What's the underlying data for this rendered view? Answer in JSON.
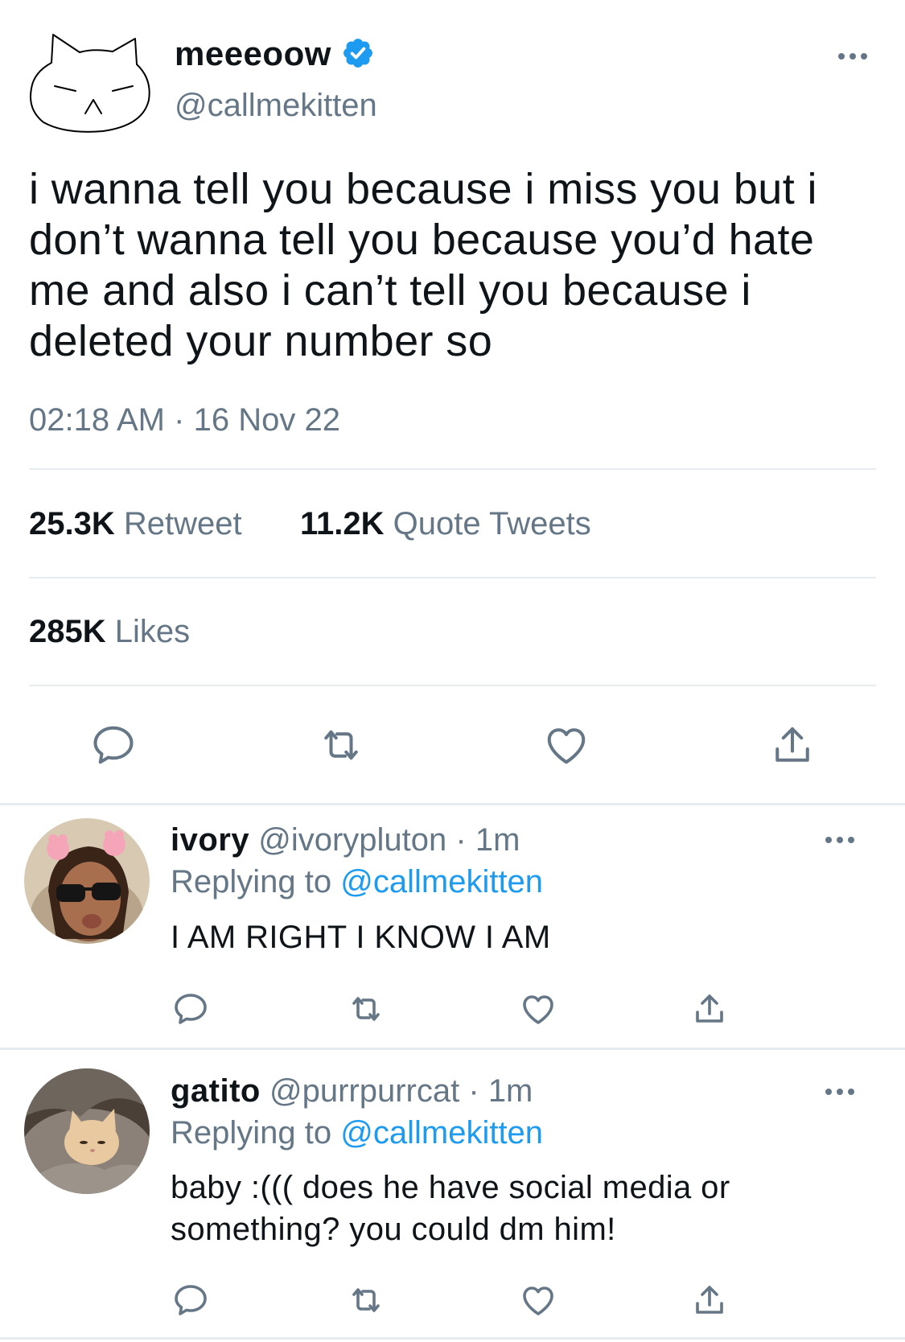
{
  "tweet": {
    "display_name": "meeeoow",
    "handle": "@callmekitten",
    "text": "i wanna tell you because i miss you but i don’t wanna tell you because you’d hate me and also i can’t tell you because i deleted your number so",
    "time": "02:18 AM",
    "separator": "·",
    "date": "16 Nov 22",
    "retweets_count": "25.3K",
    "retweets_label": "Retweet",
    "quotes_count": "11.2K",
    "quotes_label": "Quote Tweets",
    "likes_count": "285K",
    "likes_label": "Likes"
  },
  "replies": [
    {
      "display_name": "ivory",
      "handle": "@ivorypluton",
      "separator": "·",
      "age": "1m",
      "replying_label": "Replying to",
      "replying_handle": "@callmekitten",
      "text": "I AM RIGHT I KNOW I AM"
    },
    {
      "display_name": "gatito",
      "handle": "@purrpurrcat",
      "separator": "·",
      "age": "1m",
      "replying_label": "Replying to",
      "replying_handle": "@callmekitten",
      "text": "baby :((( does he have social media or something? you could dm him!"
    }
  ],
  "icons": {
    "reply": "speech-bubble-icon",
    "retweet": "retweet-arrows-icon",
    "like": "heart-icon",
    "share": "share-upload-icon",
    "more": "ellipsis-icon",
    "verified": "verified-badge-icon"
  },
  "colors": {
    "accent": "#1d9bf0",
    "secondary_text": "#657786",
    "divider": "#e6ecf0"
  }
}
